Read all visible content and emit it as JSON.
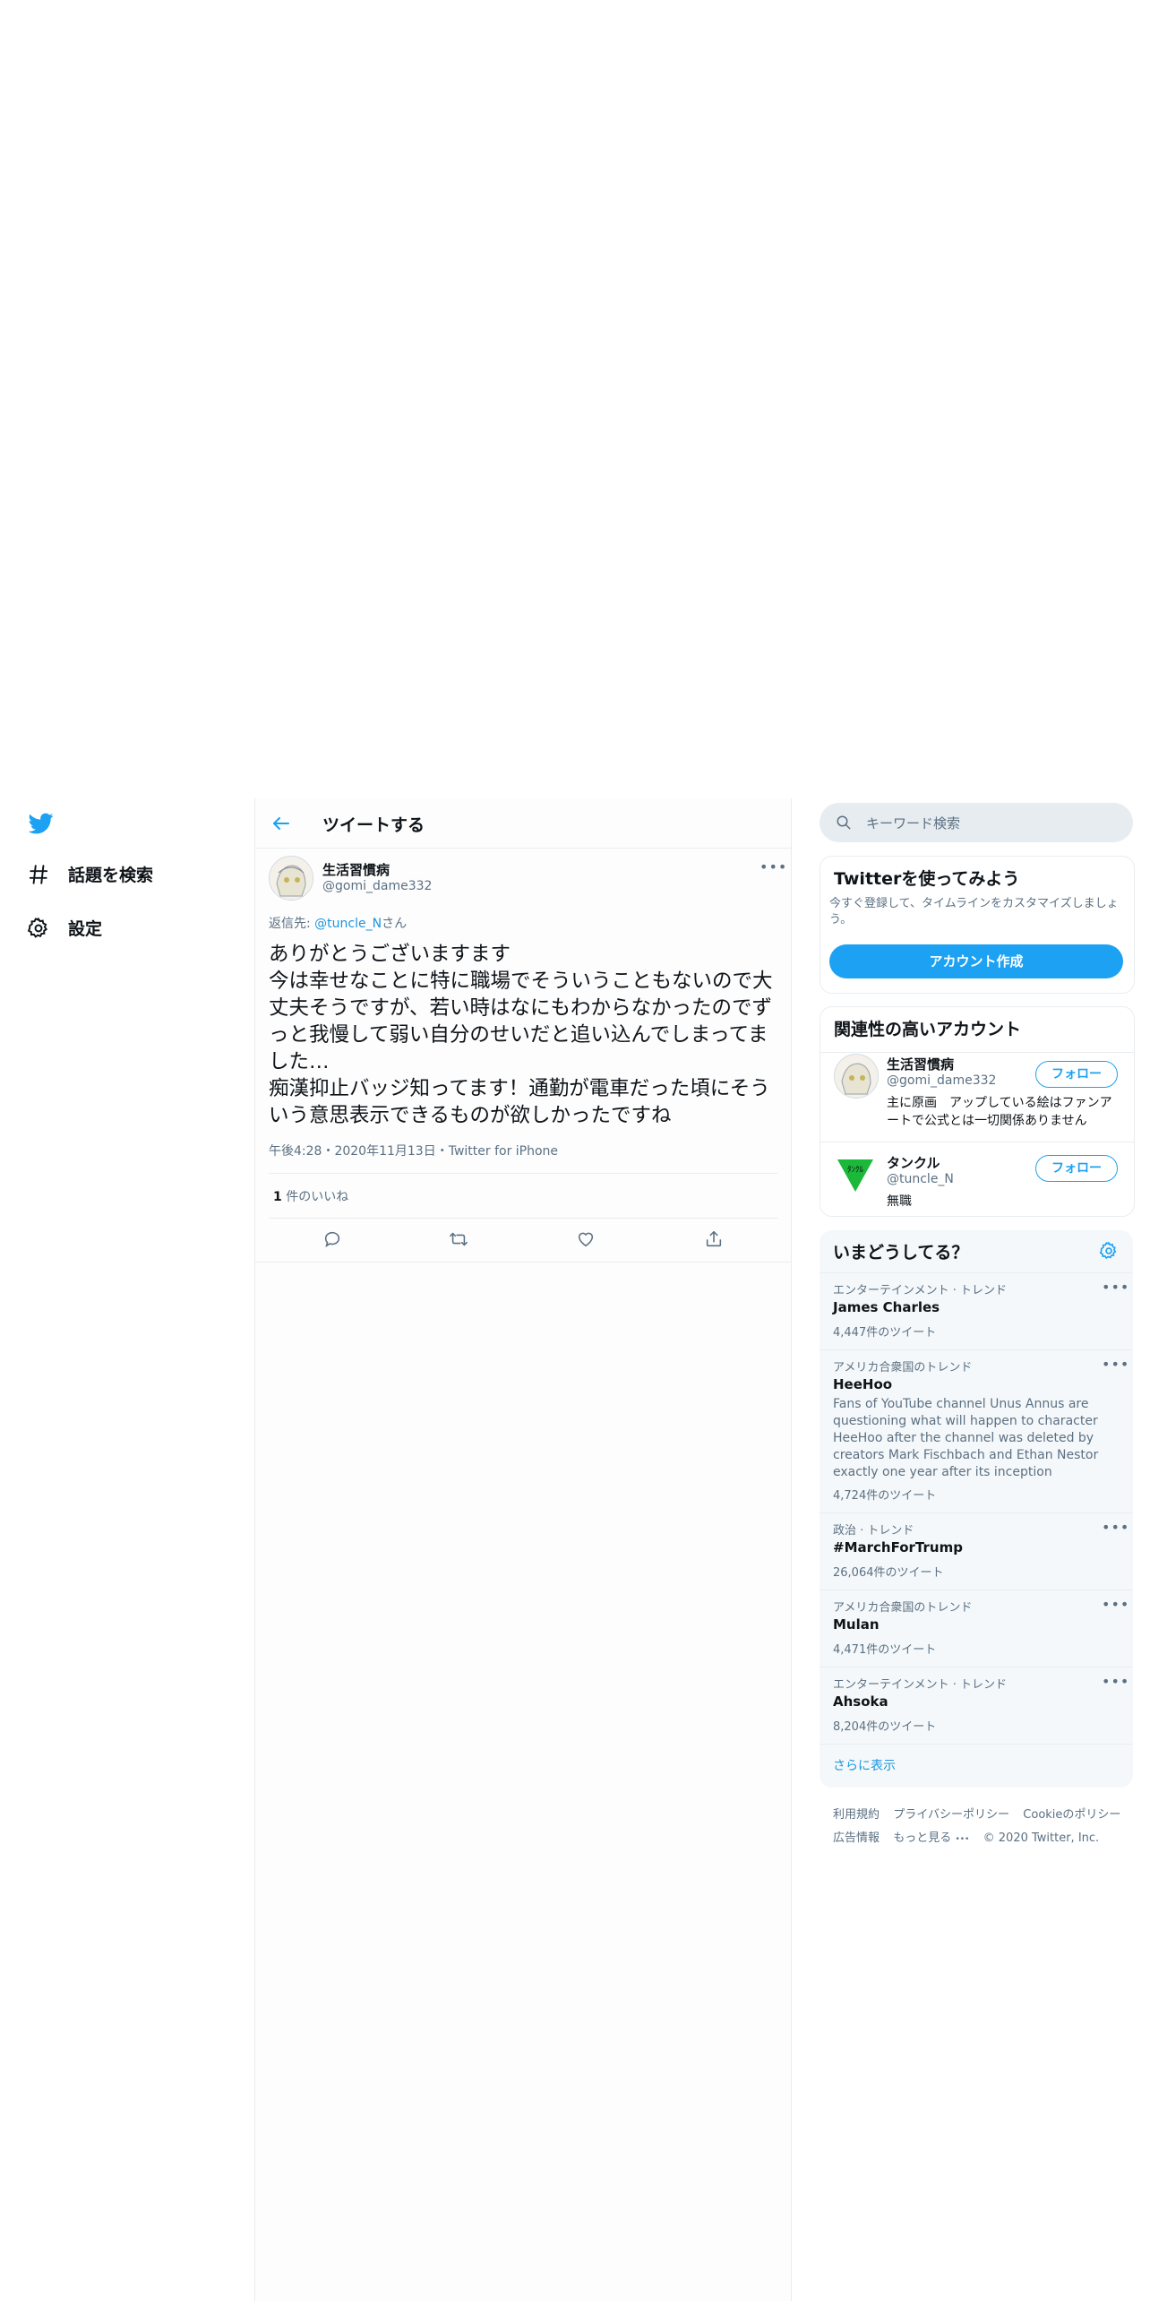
{
  "nav": {
    "explore_label": "話題を検索",
    "settings_label": "設定"
  },
  "header": {
    "title": "ツイートする"
  },
  "tweet": {
    "author_name": "生活習慣病",
    "author_handle": "@gomi_dame332",
    "reply_prefix": "返信先: ",
    "reply_handle": "@tuncle_N",
    "reply_suffix": "さん",
    "text": "ありがとうございますます\n今は幸せなことに特に職場でそういうこともないので大丈夫そうですが、若い時はなにもわからなかったのでずっと我慢して弱い自分のせいだと追い込んでしまってました…\n痴漢抑止バッジ知ってます！通勤が電車だった頃にそういう意思表示できるものが欲しかったですね",
    "time": "午後4:28",
    "date": "2020年11月13日",
    "source": "Twitter for iPhone",
    "meta_sep": "・",
    "likes_count": "1",
    "likes_label": "件のいいね"
  },
  "search": {
    "placeholder": "キーワード検索"
  },
  "signup": {
    "title": "Twitterを使ってみよう",
    "description": "今すぐ登録して、タイムラインをカスタマイズしましょう。",
    "button_label": "アカウント作成"
  },
  "relevant": {
    "title": "関連性の高いアカウント",
    "follow_label": "フォロー",
    "accounts": [
      {
        "name": "生活習慣病",
        "handle": "@gomi_dame332",
        "bio": "主に原画　アップしている絵はファンアートで公式とは一切関係ありません"
      },
      {
        "name": "タンクル",
        "handle": "@tuncle_N",
        "bio": "無職"
      }
    ]
  },
  "trends": {
    "title": "いまどうしてる？",
    "show_more": "さらに表示",
    "items": [
      {
        "category": "エンターテインメント · トレンド",
        "name": "James Charles",
        "desc": "",
        "count": "4,447件のツイート"
      },
      {
        "category": "アメリカ合衆国のトレンド",
        "name": "HeeHoo",
        "desc": "Fans of YouTube channel Unus Annus are questioning what will happen to character HeeHoo after the channel was deleted by creators Mark Fischbach and Ethan Nestor exactly one year after its inception",
        "count": "4,724件のツイート"
      },
      {
        "category": "政治 · トレンド",
        "name": "#MarchForTrump",
        "desc": "",
        "count": "26,064件のツイート"
      },
      {
        "category": "アメリカ合衆国のトレンド",
        "name": "Mulan",
        "desc": "",
        "count": "4,471件のツイート"
      },
      {
        "category": "エンターテインメント · トレンド",
        "name": "Ahsoka",
        "desc": "",
        "count": "8,204件のツイート"
      }
    ]
  },
  "footer": {
    "terms": "利用規約",
    "privacy": "プライバシーポリシー",
    "cookies": "Cookieのポリシー",
    "ads": "広告情報",
    "more": "もっと見る",
    "copyright": "© 2020 Twitter, Inc."
  },
  "colors": {
    "accent": "#1da1f2",
    "link": "#1b95e0",
    "muted": "#5b7083"
  }
}
